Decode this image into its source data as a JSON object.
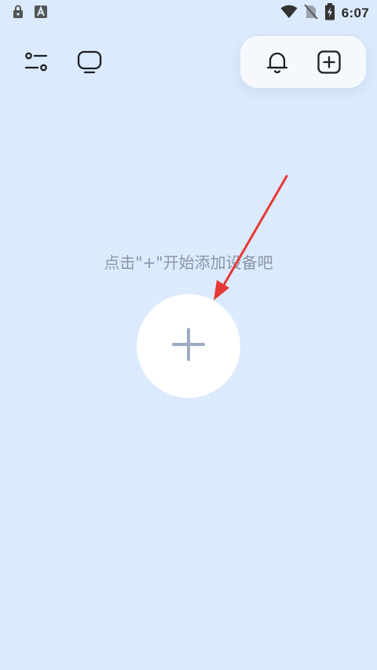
{
  "status_bar": {
    "time": "6:07",
    "left_icons": [
      "lock-notification-icon",
      "a-notification-icon"
    ],
    "right_icons": [
      "wifi-icon",
      "no-sim-icon",
      "battery-charging-icon"
    ]
  },
  "toolbar": {
    "left_icons": [
      "filter-sliders-icon",
      "tv-icon"
    ],
    "right_icons": [
      "bell-icon",
      "add-square-icon"
    ]
  },
  "empty_state": {
    "hint": "点击\"+\"开始添加设备吧",
    "add_button_icon": "plus-icon"
  },
  "annotation": {
    "arrow_color": "#e53935"
  },
  "colors": {
    "background": "#dbeafc",
    "hint_text": "#8a96a6",
    "plus_color": "#9aabc3"
  }
}
